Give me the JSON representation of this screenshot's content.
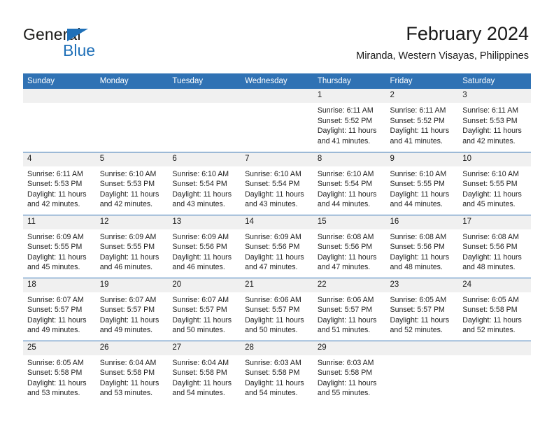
{
  "brand": {
    "name_dark": "General",
    "name_blue": "Blue",
    "logo_icon": "triangle-icon",
    "accent_color": "#1f70b8"
  },
  "header": {
    "title": "February 2024",
    "subtitle": "Miranda, Western Visayas, Philippines",
    "header_bg_color": "#3072b4",
    "daynum_bg_color": "#f0f0f0"
  },
  "calendar": {
    "weekday_headers": [
      "Sunday",
      "Monday",
      "Tuesday",
      "Wednesday",
      "Thursday",
      "Friday",
      "Saturday"
    ],
    "weeks": [
      [
        {
          "day": "",
          "lines": []
        },
        {
          "day": "",
          "lines": []
        },
        {
          "day": "",
          "lines": []
        },
        {
          "day": "",
          "lines": []
        },
        {
          "day": "1",
          "lines": [
            "Sunrise: 6:11 AM",
            "Sunset: 5:52 PM",
            "Daylight: 11 hours",
            "and 41 minutes."
          ]
        },
        {
          "day": "2",
          "lines": [
            "Sunrise: 6:11 AM",
            "Sunset: 5:52 PM",
            "Daylight: 11 hours",
            "and 41 minutes."
          ]
        },
        {
          "day": "3",
          "lines": [
            "Sunrise: 6:11 AM",
            "Sunset: 5:53 PM",
            "Daylight: 11 hours",
            "and 42 minutes."
          ]
        }
      ],
      [
        {
          "day": "4",
          "lines": [
            "Sunrise: 6:11 AM",
            "Sunset: 5:53 PM",
            "Daylight: 11 hours",
            "and 42 minutes."
          ]
        },
        {
          "day": "5",
          "lines": [
            "Sunrise: 6:10 AM",
            "Sunset: 5:53 PM",
            "Daylight: 11 hours",
            "and 42 minutes."
          ]
        },
        {
          "day": "6",
          "lines": [
            "Sunrise: 6:10 AM",
            "Sunset: 5:54 PM",
            "Daylight: 11 hours",
            "and 43 minutes."
          ]
        },
        {
          "day": "7",
          "lines": [
            "Sunrise: 6:10 AM",
            "Sunset: 5:54 PM",
            "Daylight: 11 hours",
            "and 43 minutes."
          ]
        },
        {
          "day": "8",
          "lines": [
            "Sunrise: 6:10 AM",
            "Sunset: 5:54 PM",
            "Daylight: 11 hours",
            "and 44 minutes."
          ]
        },
        {
          "day": "9",
          "lines": [
            "Sunrise: 6:10 AM",
            "Sunset: 5:55 PM",
            "Daylight: 11 hours",
            "and 44 minutes."
          ]
        },
        {
          "day": "10",
          "lines": [
            "Sunrise: 6:10 AM",
            "Sunset: 5:55 PM",
            "Daylight: 11 hours",
            "and 45 minutes."
          ]
        }
      ],
      [
        {
          "day": "11",
          "lines": [
            "Sunrise: 6:09 AM",
            "Sunset: 5:55 PM",
            "Daylight: 11 hours",
            "and 45 minutes."
          ]
        },
        {
          "day": "12",
          "lines": [
            "Sunrise: 6:09 AM",
            "Sunset: 5:55 PM",
            "Daylight: 11 hours",
            "and 46 minutes."
          ]
        },
        {
          "day": "13",
          "lines": [
            "Sunrise: 6:09 AM",
            "Sunset: 5:56 PM",
            "Daylight: 11 hours",
            "and 46 minutes."
          ]
        },
        {
          "day": "14",
          "lines": [
            "Sunrise: 6:09 AM",
            "Sunset: 5:56 PM",
            "Daylight: 11 hours",
            "and 47 minutes."
          ]
        },
        {
          "day": "15",
          "lines": [
            "Sunrise: 6:08 AM",
            "Sunset: 5:56 PM",
            "Daylight: 11 hours",
            "and 47 minutes."
          ]
        },
        {
          "day": "16",
          "lines": [
            "Sunrise: 6:08 AM",
            "Sunset: 5:56 PM",
            "Daylight: 11 hours",
            "and 48 minutes."
          ]
        },
        {
          "day": "17",
          "lines": [
            "Sunrise: 6:08 AM",
            "Sunset: 5:56 PM",
            "Daylight: 11 hours",
            "and 48 minutes."
          ]
        }
      ],
      [
        {
          "day": "18",
          "lines": [
            "Sunrise: 6:07 AM",
            "Sunset: 5:57 PM",
            "Daylight: 11 hours",
            "and 49 minutes."
          ]
        },
        {
          "day": "19",
          "lines": [
            "Sunrise: 6:07 AM",
            "Sunset: 5:57 PM",
            "Daylight: 11 hours",
            "and 49 minutes."
          ]
        },
        {
          "day": "20",
          "lines": [
            "Sunrise: 6:07 AM",
            "Sunset: 5:57 PM",
            "Daylight: 11 hours",
            "and 50 minutes."
          ]
        },
        {
          "day": "21",
          "lines": [
            "Sunrise: 6:06 AM",
            "Sunset: 5:57 PM",
            "Daylight: 11 hours",
            "and 50 minutes."
          ]
        },
        {
          "day": "22",
          "lines": [
            "Sunrise: 6:06 AM",
            "Sunset: 5:57 PM",
            "Daylight: 11 hours",
            "and 51 minutes."
          ]
        },
        {
          "day": "23",
          "lines": [
            "Sunrise: 6:05 AM",
            "Sunset: 5:57 PM",
            "Daylight: 11 hours",
            "and 52 minutes."
          ]
        },
        {
          "day": "24",
          "lines": [
            "Sunrise: 6:05 AM",
            "Sunset: 5:58 PM",
            "Daylight: 11 hours",
            "and 52 minutes."
          ]
        }
      ],
      [
        {
          "day": "25",
          "lines": [
            "Sunrise: 6:05 AM",
            "Sunset: 5:58 PM",
            "Daylight: 11 hours",
            "and 53 minutes."
          ]
        },
        {
          "day": "26",
          "lines": [
            "Sunrise: 6:04 AM",
            "Sunset: 5:58 PM",
            "Daylight: 11 hours",
            "and 53 minutes."
          ]
        },
        {
          "day": "27",
          "lines": [
            "Sunrise: 6:04 AM",
            "Sunset: 5:58 PM",
            "Daylight: 11 hours",
            "and 54 minutes."
          ]
        },
        {
          "day": "28",
          "lines": [
            "Sunrise: 6:03 AM",
            "Sunset: 5:58 PM",
            "Daylight: 11 hours",
            "and 54 minutes."
          ]
        },
        {
          "day": "29",
          "lines": [
            "Sunrise: 6:03 AM",
            "Sunset: 5:58 PM",
            "Daylight: 11 hours",
            "and 55 minutes."
          ]
        },
        {
          "day": "",
          "lines": []
        },
        {
          "day": "",
          "lines": []
        }
      ]
    ]
  }
}
